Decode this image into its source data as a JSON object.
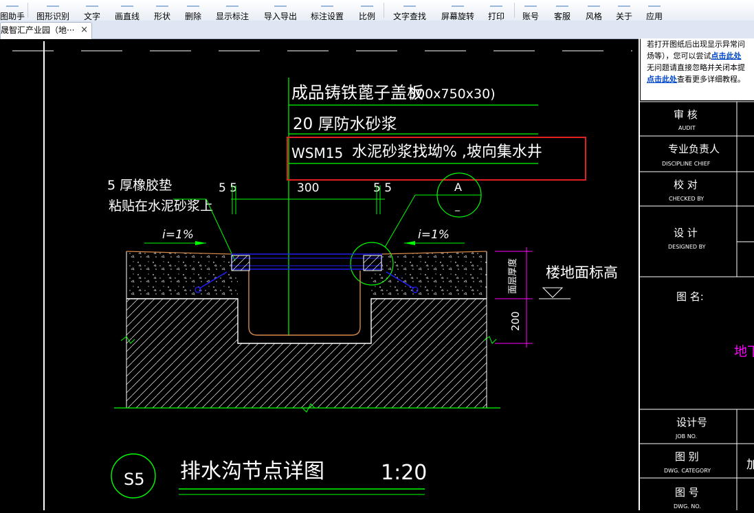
{
  "toolbar": {
    "items": [
      {
        "label": "图助手"
      },
      {
        "label": "图形识别"
      },
      {
        "label": "文字"
      },
      {
        "label": "画直线"
      },
      {
        "label": "形状"
      },
      {
        "label": "删除"
      },
      {
        "label": "显示标注"
      },
      {
        "label": "导入导出"
      },
      {
        "label": "标注设置"
      },
      {
        "label": "比例"
      },
      {
        "label": "文字查找"
      },
      {
        "label": "屏幕旋转"
      },
      {
        "label": "打印"
      },
      {
        "label": "账号"
      },
      {
        "label": "客服"
      },
      {
        "label": "风格"
      },
      {
        "label": "关于"
      },
      {
        "label": "应用"
      }
    ]
  },
  "tab": {
    "title": "晟智汇产业园（地···",
    "close": "×"
  },
  "notice": {
    "line1": "若打开图纸后出现显示异常问",
    "line2a": "炀等），您可以尝试",
    "line2b": "点击此处",
    "line3": "无问题请直接忽略并关闭本提",
    "line4a": "点击此处",
    "line4b": "查看更多详细教程。"
  },
  "drawing": {
    "layer1": "成品铸铁蓖子盖板",
    "layer1_dim": "300x750x30)",
    "layer2": "20  厚防水砂浆",
    "layer3_code": "WSM15",
    "layer3": "水泥砂浆找坳%  ,坡向集水井",
    "gasket1": "5 厚橡胶垫",
    "gasket2": "粘贴在水泥砂浆上",
    "dim_55_left": "5 5",
    "dim_300": "300",
    "dim_55_right": "5  5",
    "callout": "A",
    "callout_sub": "_",
    "slope_left": "i=1%",
    "slope_right": "i=1%",
    "floor_level": "楼地面标高",
    "surface_label": "面层厚度",
    "dim_200": "200",
    "section_id": "S5",
    "section_title": "排水沟节点详图",
    "scale": "1:20"
  },
  "titleblock": {
    "audit_cn": "审 核",
    "audit_en": "AUDIT",
    "chief_cn": "专业负责人",
    "chief_en": "DISCIPLINE CHIEF",
    "checked_cn": "校 对",
    "checked_en": "CHECKED BY",
    "designed_cn": "设 计",
    "designed_en": "DESIGNED BY",
    "drawing_name_cn": "图 名:",
    "drawing_name_value": "地下",
    "job_cn": "设计号",
    "job_en": "JOB NO.",
    "category_cn": "图 别",
    "category_en": "DWG. CATEGORY",
    "category_value": "加",
    "dwgno_cn": "图 号",
    "dwgno_en": "DWG. NO."
  },
  "colors": {
    "cad_bg": "#000000",
    "cad_green": "#00ff00",
    "cad_white": "#ffffff",
    "cad_blue": "#2020ff",
    "cad_magenta": "#ff00ff",
    "highlight_red": "#e02020",
    "link_blue": "#0046c8"
  }
}
